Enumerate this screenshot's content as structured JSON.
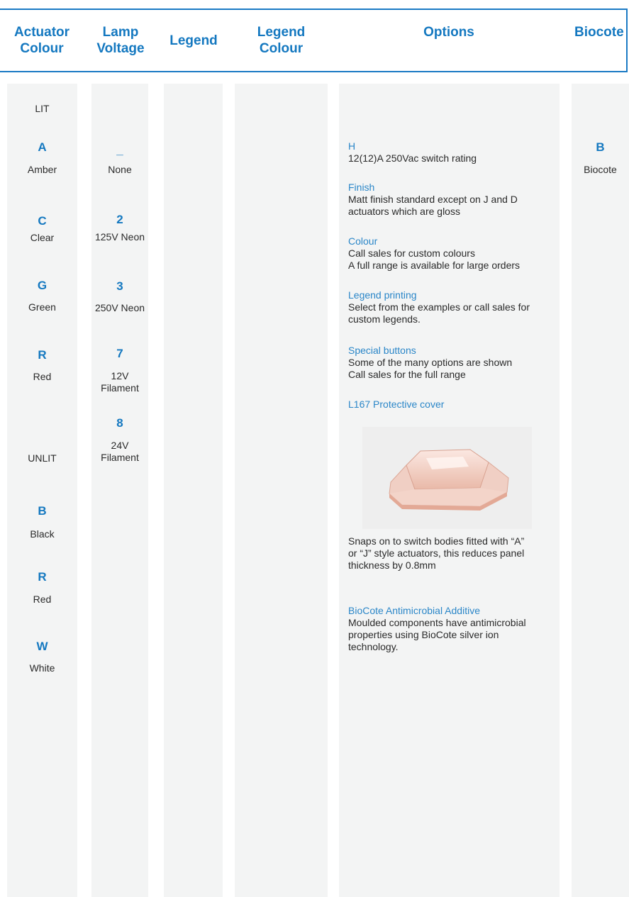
{
  "header": {
    "actuator_colour": [
      "Actuator",
      "Colour"
    ],
    "lamp_voltage": [
      "Lamp",
      "Voltage"
    ],
    "legend": "Legend",
    "legend_colour": [
      "Legend",
      "Colour"
    ],
    "options": "Options",
    "biocote": "Biocote"
  },
  "actuator": {
    "lit_label": "LIT",
    "unlit_label": "UNLIT",
    "lit": [
      {
        "code": "A",
        "name": "Amber"
      },
      {
        "code": "C",
        "name": "Clear"
      },
      {
        "code": "G",
        "name": "Green"
      },
      {
        "code": "R",
        "name": "Red"
      }
    ],
    "unlit": [
      {
        "code": "B",
        "name": "Black"
      },
      {
        "code": "R",
        "name": "Red"
      },
      {
        "code": "W",
        "name": "White"
      }
    ]
  },
  "lamp": [
    {
      "code": "_",
      "name": "None"
    },
    {
      "code": "2",
      "name": "125V Neon"
    },
    {
      "code": "3",
      "name": "250V Neon"
    },
    {
      "code": "7",
      "name_lines": [
        "12V",
        "Filament"
      ]
    },
    {
      "code": "8",
      "name_lines": [
        "24V",
        "Filament"
      ]
    }
  ],
  "options": {
    "h_title": "H",
    "h_body": "12(12)A 250Vac switch rating",
    "finish_title": "Finish",
    "finish_body": [
      "Matt finish standard except on J and D",
      "actuators which are gloss"
    ],
    "colour_title": "Colour",
    "colour_body": [
      "Call sales for custom colours",
      "A full range is available for large orders"
    ],
    "legend_title": "Legend printing",
    "legend_body": [
      "Select from the examples or call sales for",
      "custom legends."
    ],
    "special_title": "Special buttons",
    "special_body": [
      "Some of the many options are shown",
      "Call sales for the full range"
    ],
    "cover_title": "L167 Protective cover",
    "cover_body": [
      "Snaps on to switch bodies fitted with “A”",
      "or “J” style actuators, this reduces panel",
      "thickness by 0.8mm"
    ],
    "biocote_title": "BioCote Antimicrobial Additive",
    "biocote_body": [
      "Moulded components have antimicrobial",
      "properties using BioCote silver ion",
      "technology."
    ]
  },
  "biocote": {
    "code": "B",
    "name": "Biocote"
  },
  "colors": {
    "accent": "#1478c0",
    "column_bg": "#f3f4f4"
  }
}
